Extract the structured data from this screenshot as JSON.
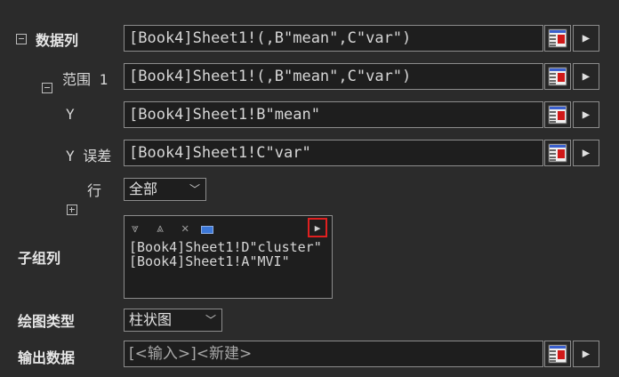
{
  "data_columns": {
    "label": "数据列",
    "value": "[Book4]Sheet1!(,B\"mean\",C\"var\")"
  },
  "range1": {
    "label": "范围 1",
    "value": "[Book4]Sheet1!(,B\"mean\",C\"var\")"
  },
  "y": {
    "label": "Y",
    "value": "[Book4]Sheet1!B\"mean\""
  },
  "y_error": {
    "label": "Y 误差",
    "value": "[Book4]Sheet1!C\"var\""
  },
  "rows": {
    "label": "行",
    "selected": "全部"
  },
  "subgroup": {
    "label": "子组列",
    "items": [
      "[Book4]Sheet1!D\"cluster\"",
      "[Book4]Sheet1!A\"MVI\""
    ]
  },
  "plot_type": {
    "label": "绘图类型",
    "selected": "柱状图"
  },
  "output": {
    "label": "输出数据",
    "value": "[<输入>]<新建>"
  },
  "icons": {
    "picker": "table-picker-icon",
    "arrow": "right-arrow-icon",
    "move_down": "move-down-icon",
    "move_up": "move-up-icon",
    "remove": "remove-icon",
    "clear": "clear-icon",
    "expand": "expand-arrow-icon"
  },
  "colors": {
    "background": "#2b2b2b",
    "highlight": "#e02020"
  }
}
